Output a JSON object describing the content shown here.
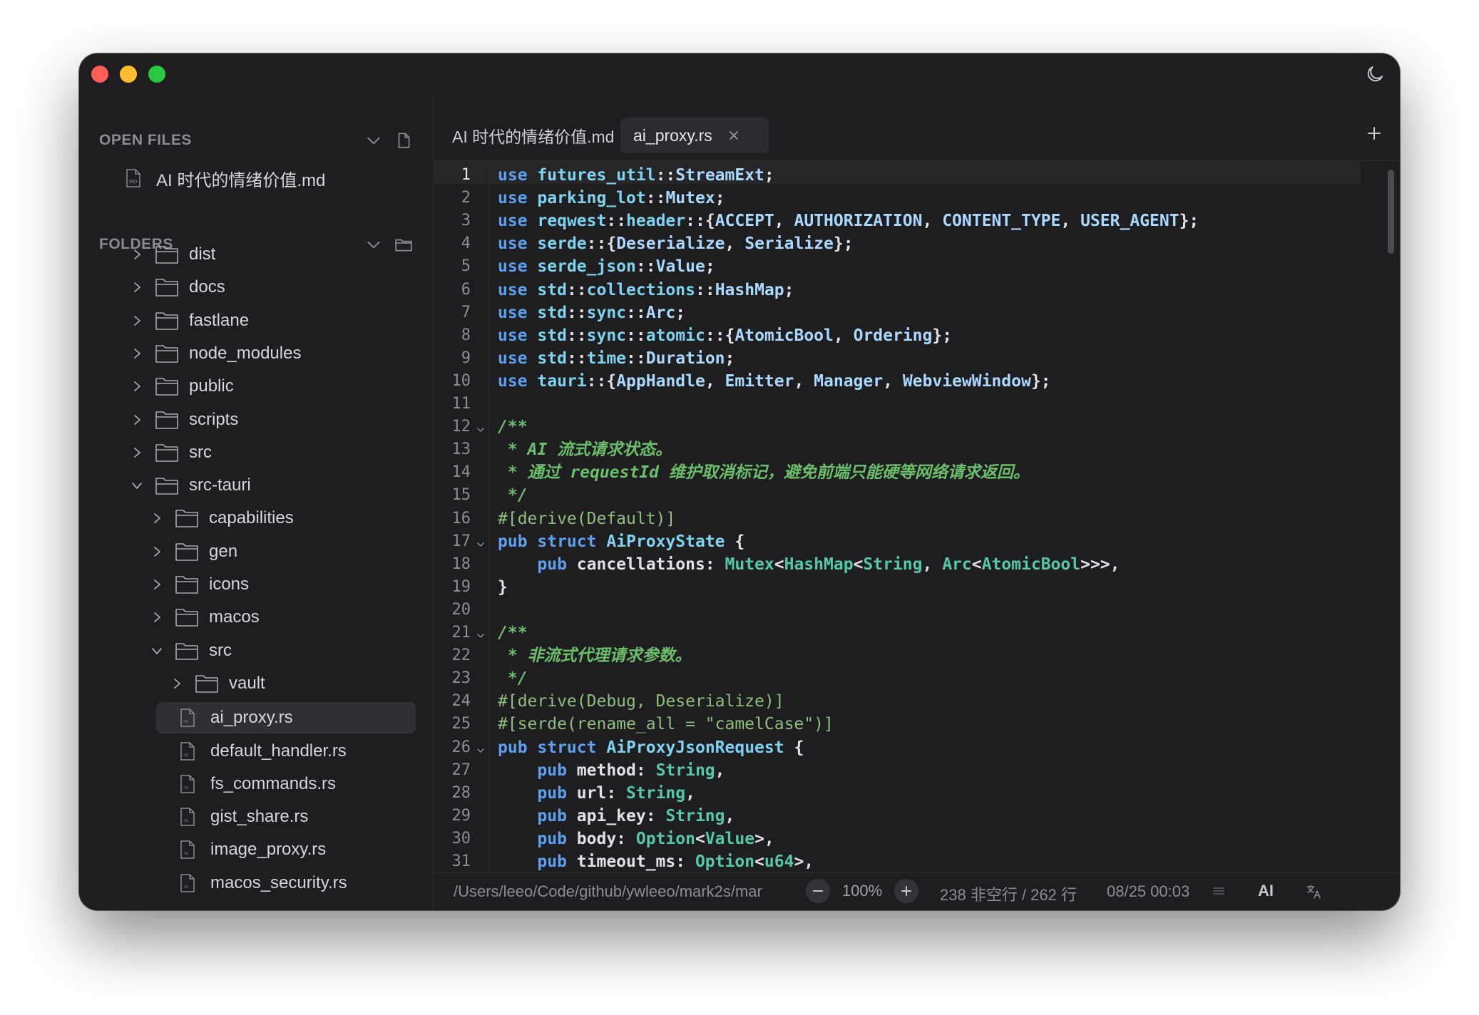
{
  "sidebar": {
    "open_files_title": "OPEN FILES",
    "open_files": [
      {
        "name": "AI 时代的情绪价值.md"
      }
    ],
    "folders_title": "FOLDERS",
    "tree": [
      {
        "label": "dist",
        "type": "folder",
        "expanded": false
      },
      {
        "label": "docs",
        "type": "folder",
        "expanded": false
      },
      {
        "label": "fastlane",
        "type": "folder",
        "expanded": false
      },
      {
        "label": "node_modules",
        "type": "folder",
        "expanded": false
      },
      {
        "label": "public",
        "type": "folder",
        "expanded": false
      },
      {
        "label": "scripts",
        "type": "folder",
        "expanded": false
      },
      {
        "label": "src",
        "type": "folder",
        "expanded": false
      },
      {
        "label": "src-tauri",
        "type": "folder",
        "expanded": true
      },
      {
        "label": "capabilities",
        "type": "folder",
        "expanded": false
      },
      {
        "label": "gen",
        "type": "folder",
        "expanded": false
      },
      {
        "label": "icons",
        "type": "folder",
        "expanded": false
      },
      {
        "label": "macos",
        "type": "folder",
        "expanded": false
      },
      {
        "label": "src",
        "type": "folder",
        "expanded": true
      },
      {
        "label": "vault",
        "type": "folder",
        "expanded": false
      },
      {
        "label": "ai_proxy.rs",
        "type": "file",
        "selected": true
      },
      {
        "label": "default_handler.rs",
        "type": "file"
      },
      {
        "label": "fs_commands.rs",
        "type": "file"
      },
      {
        "label": "gist_share.rs",
        "type": "file"
      },
      {
        "label": "image_proxy.rs",
        "type": "file"
      },
      {
        "label": "macos_security.rs",
        "type": "file"
      }
    ]
  },
  "tabs": [
    {
      "label": "AI 时代的情绪价值.md",
      "active": false
    },
    {
      "label": "ai_proxy.rs",
      "active": true
    }
  ],
  "editor": {
    "current_line": 1,
    "lines": [
      [
        [
          "kw",
          "use"
        ],
        [
          "pl",
          " "
        ],
        [
          "id",
          "futures_util"
        ],
        [
          "pl",
          "::"
        ],
        [
          "ty",
          "StreamExt"
        ],
        [
          "pl",
          ";"
        ]
      ],
      [
        [
          "kw",
          "use"
        ],
        [
          "pl",
          " "
        ],
        [
          "id",
          "parking_lot"
        ],
        [
          "pl",
          "::"
        ],
        [
          "ty",
          "Mutex"
        ],
        [
          "pl",
          ";"
        ]
      ],
      [
        [
          "kw",
          "use"
        ],
        [
          "pl",
          " "
        ],
        [
          "id",
          "reqwest"
        ],
        [
          "pl",
          "::"
        ],
        [
          "id",
          "header"
        ],
        [
          "pl",
          "::{"
        ],
        [
          "ty",
          "ACCEPT"
        ],
        [
          "pl",
          ", "
        ],
        [
          "ty",
          "AUTHORIZATION"
        ],
        [
          "pl",
          ", "
        ],
        [
          "ty",
          "CONTENT_TYPE"
        ],
        [
          "pl",
          ", "
        ],
        [
          "ty",
          "USER_AGENT"
        ],
        [
          "pl",
          "};"
        ]
      ],
      [
        [
          "kw",
          "use"
        ],
        [
          "pl",
          " "
        ],
        [
          "id",
          "serde"
        ],
        [
          "pl",
          "::{"
        ],
        [
          "ty",
          "Deserialize"
        ],
        [
          "pl",
          ", "
        ],
        [
          "ty",
          "Serialize"
        ],
        [
          "pl",
          "};"
        ]
      ],
      [
        [
          "kw",
          "use"
        ],
        [
          "pl",
          " "
        ],
        [
          "id",
          "serde_json"
        ],
        [
          "pl",
          "::"
        ],
        [
          "ty",
          "Value"
        ],
        [
          "pl",
          ";"
        ]
      ],
      [
        [
          "kw",
          "use"
        ],
        [
          "pl",
          " "
        ],
        [
          "id",
          "std"
        ],
        [
          "pl",
          "::"
        ],
        [
          "id",
          "collections"
        ],
        [
          "pl",
          "::"
        ],
        [
          "ty",
          "HashMap"
        ],
        [
          "pl",
          ";"
        ]
      ],
      [
        [
          "kw",
          "use"
        ],
        [
          "pl",
          " "
        ],
        [
          "id",
          "std"
        ],
        [
          "pl",
          "::"
        ],
        [
          "id",
          "sync"
        ],
        [
          "pl",
          "::"
        ],
        [
          "ty",
          "Arc"
        ],
        [
          "pl",
          ";"
        ]
      ],
      [
        [
          "kw",
          "use"
        ],
        [
          "pl",
          " "
        ],
        [
          "id",
          "std"
        ],
        [
          "pl",
          "::"
        ],
        [
          "id",
          "sync"
        ],
        [
          "pl",
          "::"
        ],
        [
          "id",
          "atomic"
        ],
        [
          "pl",
          "::{"
        ],
        [
          "ty",
          "AtomicBool"
        ],
        [
          "pl",
          ", "
        ],
        [
          "ty",
          "Ordering"
        ],
        [
          "pl",
          "};"
        ]
      ],
      [
        [
          "kw",
          "use"
        ],
        [
          "pl",
          " "
        ],
        [
          "id",
          "std"
        ],
        [
          "pl",
          "::"
        ],
        [
          "id",
          "time"
        ],
        [
          "pl",
          "::"
        ],
        [
          "ty",
          "Duration"
        ],
        [
          "pl",
          ";"
        ]
      ],
      [
        [
          "kw",
          "use"
        ],
        [
          "pl",
          " "
        ],
        [
          "id",
          "tauri"
        ],
        [
          "pl",
          "::{"
        ],
        [
          "ty",
          "AppHandle"
        ],
        [
          "pl",
          ", "
        ],
        [
          "ty",
          "Emitter"
        ],
        [
          "pl",
          ", "
        ],
        [
          "ty",
          "Manager"
        ],
        [
          "pl",
          ", "
        ],
        [
          "ty",
          "WebviewWindow"
        ],
        [
          "pl",
          "};"
        ]
      ],
      [],
      [
        [
          "cm",
          "/**"
        ]
      ],
      [
        [
          "cm",
          " * AI 流式请求状态。"
        ]
      ],
      [
        [
          "cm",
          " * 通过 requestId 维护取消标记，避免前端只能硬等网络请求返回。"
        ]
      ],
      [
        [
          "cm",
          " */"
        ]
      ],
      [
        [
          "at",
          "#[derive(Default)]"
        ]
      ],
      [
        [
          "kw",
          "pub struct"
        ],
        [
          "pl",
          " "
        ],
        [
          "id",
          "AiProxyState"
        ],
        [
          "pl",
          " {"
        ]
      ],
      [
        [
          "pl",
          "    "
        ],
        [
          "kw",
          "pub"
        ],
        [
          "pl",
          " cancellations: "
        ],
        [
          "gr",
          "Mutex"
        ],
        [
          "pl",
          "<"
        ],
        [
          "gr",
          "HashMap"
        ],
        [
          "pl",
          "<"
        ],
        [
          "gr",
          "String"
        ],
        [
          "pl",
          ", "
        ],
        [
          "gr",
          "Arc"
        ],
        [
          "pl",
          "<"
        ],
        [
          "gr",
          "AtomicBool"
        ],
        [
          "pl",
          ">>>,"
        ]
      ],
      [
        [
          "pl",
          "}"
        ]
      ],
      [],
      [
        [
          "cm",
          "/**"
        ]
      ],
      [
        [
          "cm",
          " * 非流式代理请求参数。"
        ]
      ],
      [
        [
          "cm",
          " */"
        ]
      ],
      [
        [
          "at",
          "#[derive(Debug, Deserialize)]"
        ]
      ],
      [
        [
          "at",
          "#[serde(rename_all = \"camelCase\")]"
        ]
      ],
      [
        [
          "kw",
          "pub struct"
        ],
        [
          "pl",
          " "
        ],
        [
          "id",
          "AiProxyJsonRequest"
        ],
        [
          "pl",
          " {"
        ]
      ],
      [
        [
          "pl",
          "    "
        ],
        [
          "kw",
          "pub"
        ],
        [
          "pl",
          " method: "
        ],
        [
          "gr",
          "String"
        ],
        [
          "pl",
          ","
        ]
      ],
      [
        [
          "pl",
          "    "
        ],
        [
          "kw",
          "pub"
        ],
        [
          "pl",
          " url: "
        ],
        [
          "gr",
          "String"
        ],
        [
          "pl",
          ","
        ]
      ],
      [
        [
          "pl",
          "    "
        ],
        [
          "kw",
          "pub"
        ],
        [
          "pl",
          " api_key: "
        ],
        [
          "gr",
          "String"
        ],
        [
          "pl",
          ","
        ]
      ],
      [
        [
          "pl",
          "    "
        ],
        [
          "kw",
          "pub"
        ],
        [
          "pl",
          " body: "
        ],
        [
          "gr",
          "Option"
        ],
        [
          "pl",
          "<"
        ],
        [
          "gr",
          "Value"
        ],
        [
          "pl",
          ">,"
        ]
      ],
      [
        [
          "pl",
          "    "
        ],
        [
          "kw",
          "pub"
        ],
        [
          "pl",
          " timeout_ms: "
        ],
        [
          "gr",
          "Option"
        ],
        [
          "pl",
          "<"
        ],
        [
          "gr",
          "u64"
        ],
        [
          "pl",
          ">,"
        ]
      ],
      [
        [
          "pl",
          "}"
        ]
      ]
    ],
    "fold_lines": [
      12,
      17,
      21,
      26
    ]
  },
  "status": {
    "path": "/Users/leeo/Code/github/ywleeo/mark2s/mar",
    "zoom": "100%",
    "line_stats": "238 非空行 / 262 行",
    "timestamp": "08/25 00:03",
    "ai_label": "AI"
  },
  "colors": {
    "window_bg": "#1e1e20",
    "keyword": "#5ca0f2",
    "comment": "#6bbf6a",
    "type": "#56c7a8"
  }
}
